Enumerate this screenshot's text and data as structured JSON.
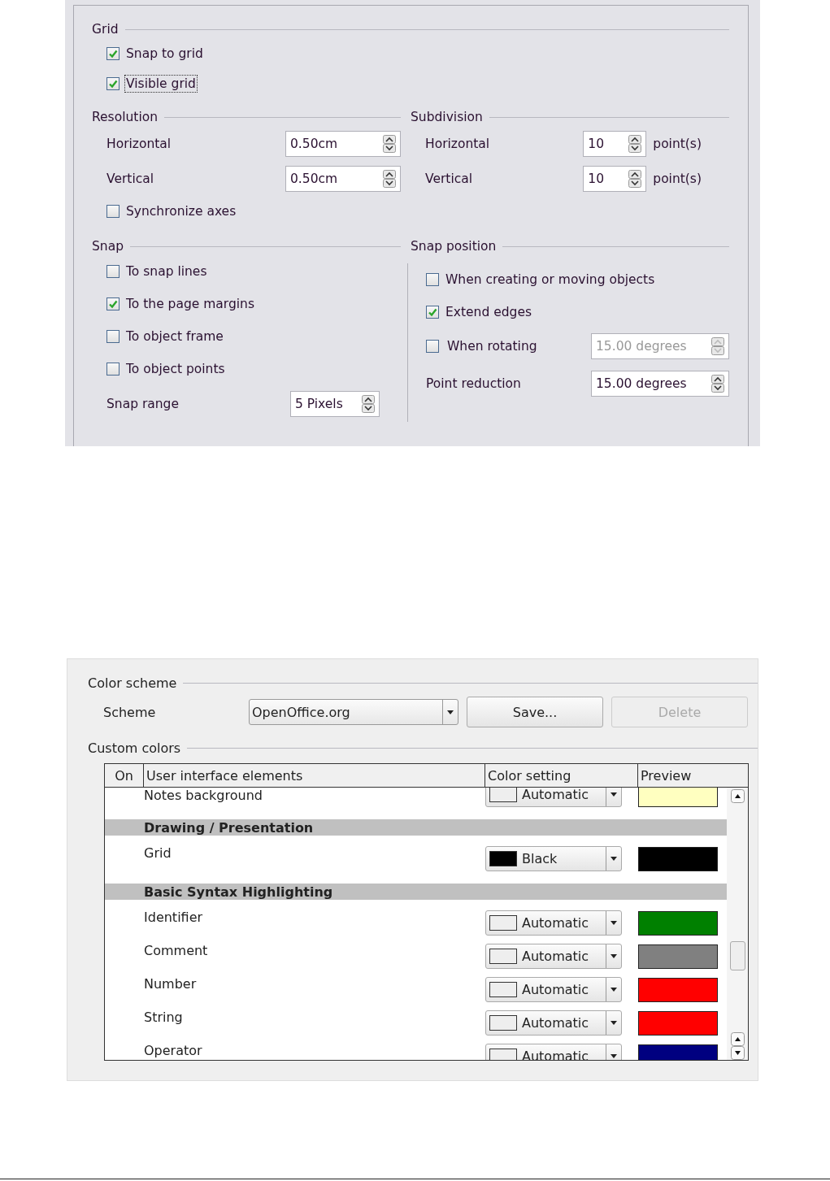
{
  "grid": {
    "title": "Grid",
    "options": [
      {
        "label": "Snap to grid",
        "checked": true,
        "focused": false
      },
      {
        "label": "Visible grid",
        "checked": true,
        "focused": true
      }
    ]
  },
  "resolution": {
    "title": "Resolution",
    "fields": [
      {
        "label": "Horizontal",
        "value": "0.50cm"
      },
      {
        "label": "Vertical",
        "value": "0.50cm"
      }
    ],
    "sync": {
      "label": "Synchronize axes",
      "checked": false
    }
  },
  "subdivision": {
    "title": "Subdivision",
    "fields": [
      {
        "label": "Horizontal",
        "value": "10",
        "unit": "point(s)"
      },
      {
        "label": "Vertical",
        "value": "10",
        "unit": "point(s)"
      }
    ]
  },
  "snap": {
    "title": "Snap",
    "options": [
      {
        "label": "To snap lines",
        "checked": false
      },
      {
        "label": "To the page margins",
        "checked": true
      },
      {
        "label": "To object frame",
        "checked": false
      },
      {
        "label": "To object points",
        "checked": false
      }
    ],
    "range": {
      "label": "Snap range",
      "value": "5 Pixels"
    }
  },
  "snap_position": {
    "title": "Snap position",
    "rows": [
      {
        "kind": "check",
        "label": "When creating or moving objects",
        "checked": false
      },
      {
        "kind": "check",
        "label": "Extend edges",
        "checked": true
      },
      {
        "kind": "check-field",
        "label": "When rotating",
        "checked": false,
        "value": "15.00 degrees",
        "disabled": true
      },
      {
        "kind": "field",
        "label": "Point reduction",
        "value": "15.00 degrees",
        "disabled": false
      }
    ]
  },
  "color_scheme": {
    "title": "Color scheme",
    "label": "Scheme",
    "value": "OpenOffice.org",
    "buttons": [
      {
        "label": "Save...",
        "disabled": false
      },
      {
        "label": "Delete",
        "disabled": true
      }
    ]
  },
  "custom_colors": {
    "title": "Custom colors",
    "columns": [
      "On",
      "User interface elements",
      "Color setting",
      "Preview"
    ],
    "rows": [
      {
        "kind": "item",
        "label": "Notes background",
        "setting": "Automatic",
        "automatic": true,
        "color": "#ffffc0"
      },
      {
        "kind": "group",
        "label": "Drawing / Presentation"
      },
      {
        "kind": "item",
        "label": "Grid",
        "setting": "Black",
        "automatic": false,
        "color": "#000000"
      },
      {
        "kind": "group",
        "label": "Basic Syntax Highlighting"
      },
      {
        "kind": "item",
        "label": "Identifier",
        "setting": "Automatic",
        "automatic": true,
        "color": "#008000"
      },
      {
        "kind": "item",
        "label": "Comment",
        "setting": "Automatic",
        "automatic": true,
        "color": "#808080"
      },
      {
        "kind": "item",
        "label": "Number",
        "setting": "Automatic",
        "automatic": true,
        "color": "#ff0000"
      },
      {
        "kind": "item",
        "label": "String",
        "setting": "Automatic",
        "automatic": true,
        "color": "#ff0000"
      },
      {
        "kind": "item",
        "label": "Operator",
        "setting": "Automatic",
        "automatic": true,
        "color": "#000080"
      }
    ]
  }
}
